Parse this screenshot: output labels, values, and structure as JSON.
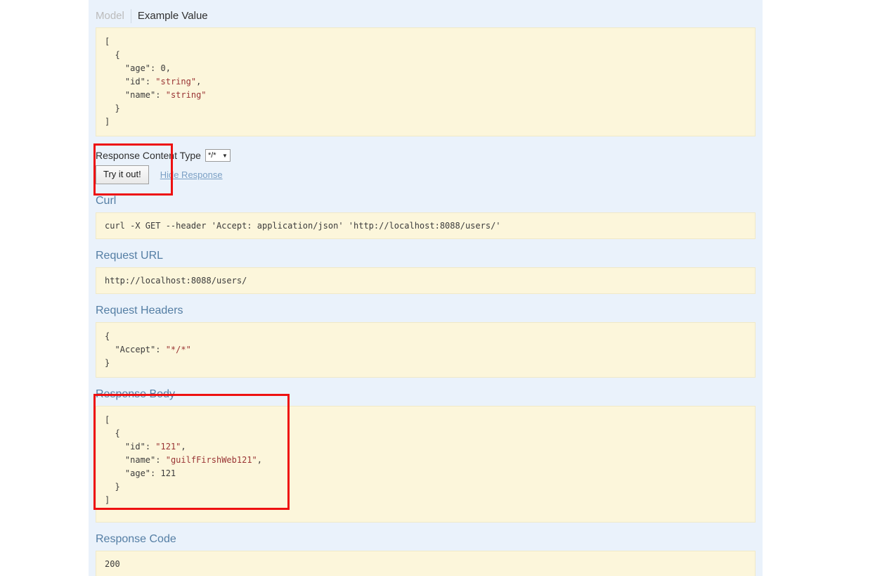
{
  "model_tabs": {
    "model_label": "Model",
    "example_label": "Example Value"
  },
  "example_value": {
    "lines": [
      "[",
      "  {",
      "    \"age\": 0,",
      "    \"id\": \"string\",",
      "    \"name\": \"string\"",
      "  }",
      "]"
    ],
    "text": "[\n  {\n    \"age\": 0,\n    \"id\": \"string\",\n    \"name\": \"string\"\n  }\n]"
  },
  "response_content_type": {
    "label": "Response Content Type",
    "selected": "*/*",
    "caret_icon": "chevron-down-icon",
    "options": [
      "*/*"
    ]
  },
  "actions": {
    "try_it_out": "Try it out!",
    "hide_response": "Hide Response"
  },
  "curl": {
    "title": "Curl",
    "command": "curl -X GET --header 'Accept: application/json' 'http://localhost:8088/users/'"
  },
  "request_url": {
    "title": "Request URL",
    "url": "http://localhost:8088/users/"
  },
  "request_headers": {
    "title": "Request Headers",
    "text": "{\n  \"Accept\": \"*/*\"\n}"
  },
  "response_body": {
    "title": "Response Body",
    "text": "[\n  {\n    \"id\": \"121\",\n    \"name\": \"guilfFirshWeb121\",\n    \"age\": 121\n  }\n]",
    "values": {
      "id": "121",
      "name": "guilfFirshWeb121",
      "age": 121
    }
  },
  "response_code": {
    "title": "Response Code",
    "code": "200"
  },
  "annotations": {
    "highlight_color": "#ee1111",
    "box_1_target": "response-content-type-area",
    "box_2_target": "response-body-json"
  }
}
